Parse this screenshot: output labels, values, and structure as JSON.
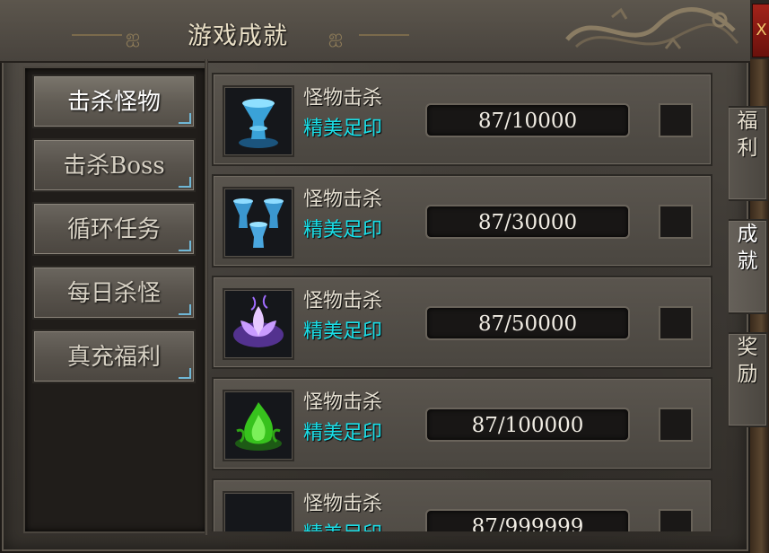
{
  "window": {
    "title": "游戏成就",
    "close_label": "X"
  },
  "nav": {
    "items": [
      {
        "label": "击杀怪物",
        "active": true
      },
      {
        "label": "击杀Boss",
        "active": false
      },
      {
        "label": "循环任务",
        "active": false
      },
      {
        "label": "每日杀怪",
        "active": false
      },
      {
        "label": "真充福利",
        "active": false
      }
    ]
  },
  "achievements": [
    {
      "title": "怪物击杀",
      "reward": "精美足印",
      "progress": "87/10000",
      "icon": "blue-cup-icon"
    },
    {
      "title": "怪物击杀",
      "reward": "精美足印",
      "progress": "87/30000",
      "icon": "blue-twin-cup-icon"
    },
    {
      "title": "怪物击杀",
      "reward": "精美足印",
      "progress": "87/50000",
      "icon": "purple-lotus-icon"
    },
    {
      "title": "怪物击杀",
      "reward": "精美足印",
      "progress": "87/100000",
      "icon": "green-flame-icon"
    },
    {
      "title": "怪物击杀",
      "reward": "精美足印",
      "progress": "87/999999",
      "icon": "dark-icon"
    }
  ],
  "side_tabs": [
    {
      "c1": "福",
      "c2": "利"
    },
    {
      "c1": "成",
      "c2": "就"
    },
    {
      "c1": "奖",
      "c2": "励"
    }
  ],
  "colors": {
    "reward_text": "#19dfe8",
    "title_text": "#e9dfc6"
  }
}
